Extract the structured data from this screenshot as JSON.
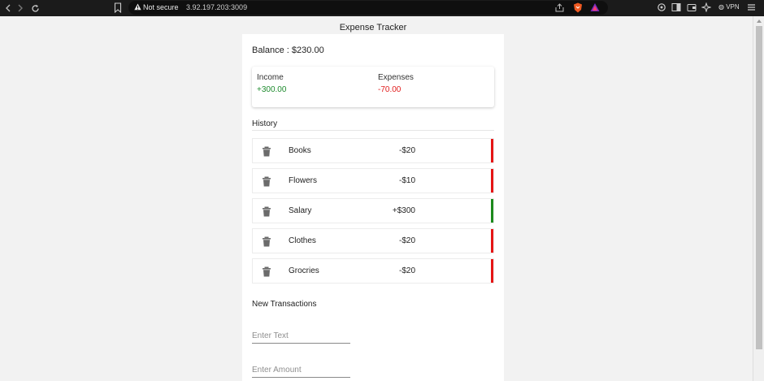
{
  "browser": {
    "not_secure": "Not secure",
    "url": "3.92.197.203:3009",
    "vpn": "VPN"
  },
  "app": {
    "title": "Expense Tracker",
    "balance": "Balance : $230.00",
    "income_label": "Income",
    "income_value": "+300.00",
    "expenses_label": "Expenses",
    "expenses_value": "-70.00",
    "history_label": "History",
    "transactions": [
      {
        "name": "Books",
        "amount": "-$20",
        "type": "expense"
      },
      {
        "name": "Flowers",
        "amount": "-$10",
        "type": "expense"
      },
      {
        "name": "Salary",
        "amount": "+$300",
        "type": "income"
      },
      {
        "name": "Clothes",
        "amount": "-$20",
        "type": "expense"
      },
      {
        "name": "Grocries",
        "amount": "-$20",
        "type": "expense"
      }
    ],
    "new_tx_label": "New Transactions",
    "text_placeholder": "Enter Text",
    "amount_placeholder": "Enter Amount"
  },
  "colors": {
    "income": "#1e8b2e",
    "expense": "#e11d1d",
    "income_bar": "#1c8a1c",
    "expense_bar": "#e51515",
    "icons": {
      "delete": "trash-icon"
    }
  }
}
